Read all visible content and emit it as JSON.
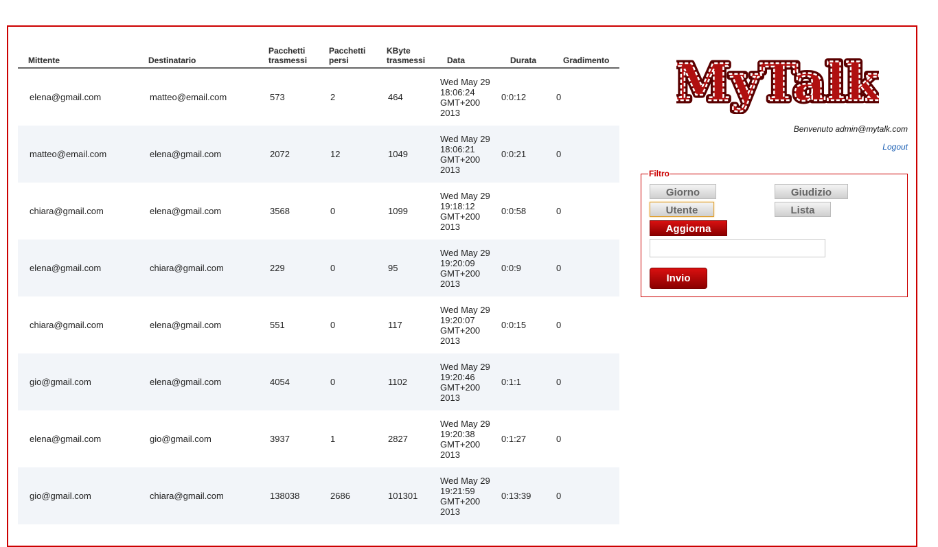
{
  "table": {
    "headers": [
      "Mittente",
      "Destinatario",
      "Pacchetti trasmessi",
      "Pacchetti persi",
      "KByte trasmessi",
      "Data",
      "Durata",
      "Gradimento"
    ],
    "rows": [
      {
        "mittente": "elena@gmail.com",
        "destinatario": "matteo@email.com",
        "trasmessi": "573",
        "persi": "2",
        "kbyte": "464",
        "data": "Wed May 29 18:06:24 GMT+200 2013",
        "durata": "0:0:12",
        "gradimento": "0"
      },
      {
        "mittente": "matteo@email.com",
        "destinatario": "elena@gmail.com",
        "trasmessi": "2072",
        "persi": "12",
        "kbyte": "1049",
        "data": "Wed May 29 18:06:21 GMT+200 2013",
        "durata": "0:0:21",
        "gradimento": "0"
      },
      {
        "mittente": "chiara@gmail.com",
        "destinatario": "elena@gmail.com",
        "trasmessi": "3568",
        "persi": "0",
        "kbyte": "1099",
        "data": "Wed May 29 19:18:12 GMT+200 2013",
        "durata": "0:0:58",
        "gradimento": "0"
      },
      {
        "mittente": "elena@gmail.com",
        "destinatario": "chiara@gmail.com",
        "trasmessi": "229",
        "persi": "0",
        "kbyte": "95",
        "data": "Wed May 29 19:20:09 GMT+200 2013",
        "durata": "0:0:9",
        "gradimento": "0"
      },
      {
        "mittente": "chiara@gmail.com",
        "destinatario": "elena@gmail.com",
        "trasmessi": "551",
        "persi": "0",
        "kbyte": "117",
        "data": "Wed May 29 19:20:07 GMT+200 2013",
        "durata": "0:0:15",
        "gradimento": "0"
      },
      {
        "mittente": "gio@gmail.com",
        "destinatario": "elena@gmail.com",
        "trasmessi": "4054",
        "persi": "0",
        "kbyte": "1102",
        "data": "Wed May 29 19:20:46 GMT+200 2013",
        "durata": "0:1:1",
        "gradimento": "0"
      },
      {
        "mittente": "elena@gmail.com",
        "destinatario": "gio@gmail.com",
        "trasmessi": "3937",
        "persi": "1",
        "kbyte": "2827",
        "data": "Wed May 29 19:20:38 GMT+200 2013",
        "durata": "0:1:27",
        "gradimento": "0"
      },
      {
        "mittente": "gio@gmail.com",
        "destinatario": "chiara@gmail.com",
        "trasmessi": "138038",
        "persi": "2686",
        "kbyte": "101301",
        "data": "Wed May 29 19:21:59 GMT+200 2013",
        "durata": "0:13:39",
        "gradimento": "0"
      }
    ]
  },
  "logo": {
    "text": "MyTalk",
    "fill": "#b01010",
    "outline": "#5a0000"
  },
  "header": {
    "welcome": "Benvenuto admin@mytalk.com",
    "logout": "Logout"
  },
  "filtro": {
    "legend": "Filtro",
    "buttons": {
      "giorno": "Giorno",
      "giudizio": "Giudizio",
      "utente": "Utente",
      "lista": "Lista"
    },
    "selected": "Utente",
    "aggiorna": "Aggiorna",
    "input_value": "",
    "invio": "Invio"
  },
  "colors": {
    "accent": "#cc0000",
    "row_alt": "#f2f5f9",
    "link": "#1a5fb4"
  }
}
